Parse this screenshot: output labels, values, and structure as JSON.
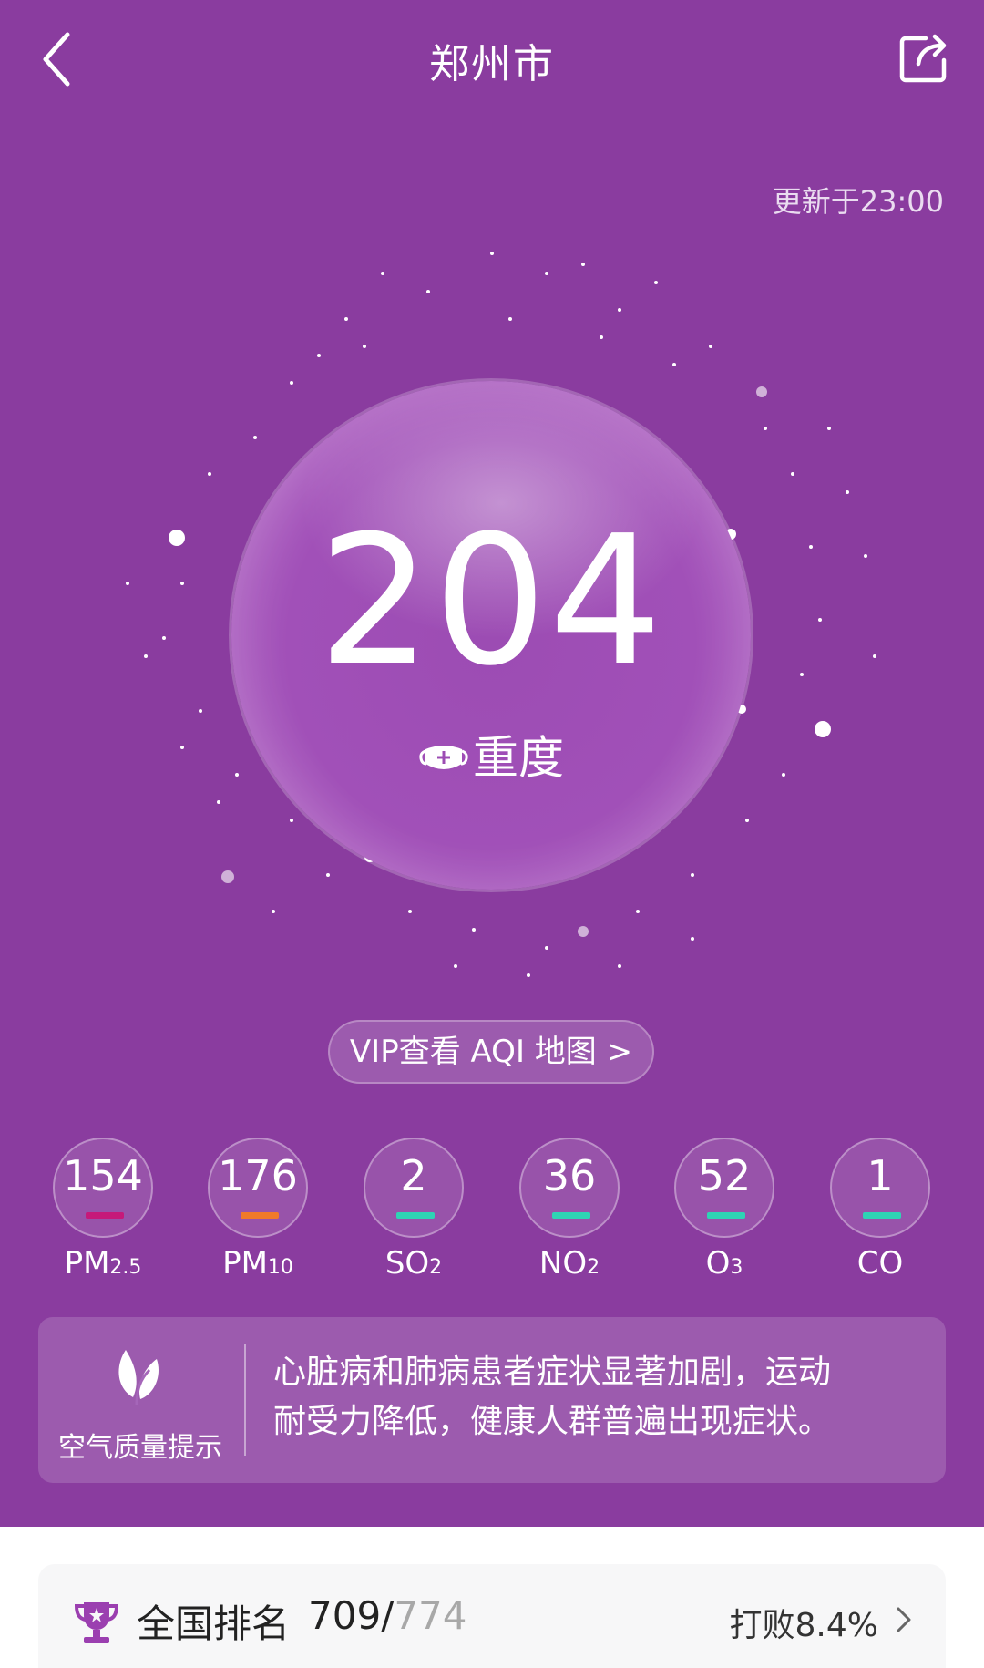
{
  "header": {
    "title": "郑州市",
    "back_icon": "chevron-left-icon",
    "share_icon": "share-icon",
    "updated": "更新于23:00"
  },
  "aqi": {
    "value": "204",
    "level": "重度",
    "level_icon": "mask-icon"
  },
  "vip_button": {
    "label": "VIP查看 AQI 地图 >"
  },
  "pollutants": [
    {
      "value": "154",
      "name": "PM",
      "sub": "2.5",
      "color": "#c6197a"
    },
    {
      "value": "176",
      "name": "PM",
      "sub": "10",
      "color": "#f07a2a"
    },
    {
      "value": "2",
      "name": "SO",
      "sub": "2",
      "color": "#2fd3b4"
    },
    {
      "value": "36",
      "name": "NO",
      "sub": "2",
      "color": "#2fd3b4"
    },
    {
      "value": "52",
      "name": "O",
      "sub": "3",
      "color": "#2fd3b4"
    },
    {
      "value": "1",
      "name": "CO",
      "sub": "",
      "color": "#2fd3b4"
    }
  ],
  "tip": {
    "icon": "leaf-icon",
    "label": "空气质量提示",
    "line1": "心脏病和肺病患者症状显著加剧，运动",
    "line2": "耐受力降低，健康人群普遍出现症状。"
  },
  "ranking": {
    "icon": "trophy-icon",
    "label": "全国排名",
    "rank": "709/",
    "total": "774",
    "beat": "打败8.4%"
  },
  "colors": {
    "background": "#8a3c9f",
    "good": "#2fd3b4"
  }
}
